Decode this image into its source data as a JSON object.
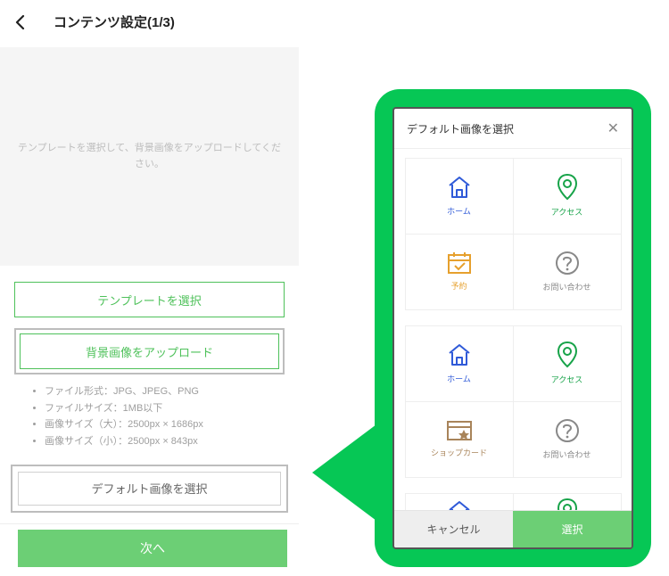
{
  "header": {
    "title": "コンテンツ設定(1/3)"
  },
  "instruction": "テンプレートを選択して、背景画像をアップロードしてください。",
  "buttons": {
    "select_template": "テンプレートを選択",
    "upload_bg": "背景画像をアップロード",
    "default_image": "デフォルト画像を選択",
    "next": "次へ"
  },
  "file_info": [
    "ファイル形式：JPG、JPEG、PNG",
    "ファイルサイズ：1MB以下",
    "画像サイズ（大）：2500px × 1686px",
    "画像サイズ（小）：2500px × 843px"
  ],
  "modal": {
    "title": "デフォルト画像を選択",
    "cancel": "キャンセル",
    "select": "選択",
    "tiles": {
      "home": "ホーム",
      "access": "アクセス",
      "reserve": "予約",
      "inquiry": "お問い合わせ",
      "shopcard": "ショップカード"
    }
  }
}
